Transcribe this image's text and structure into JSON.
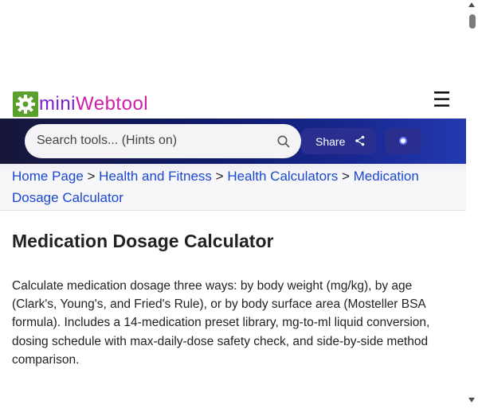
{
  "header": {
    "brand_prefix": "mini",
    "brand_suffix": "Webtool",
    "logo_color": "#5aa02c",
    "menu_icon": "hamburger-icon"
  },
  "search": {
    "placeholder": "Search tools... (Hints on)",
    "icon": "search-icon"
  },
  "actions": {
    "share_label": "Share",
    "share_icon": "share-icon",
    "theme_icon": "theme-toggle-icon"
  },
  "breadcrumb": {
    "items": [
      "Home Page",
      "Health and Fitness",
      "Health Calculators",
      "Medication Dosage Calculator"
    ],
    "separator": ">"
  },
  "main": {
    "title": "Medication Dosage Calculator",
    "description": "Calculate medication dosage three ways: by body weight (mg/kg), by age (Clark's, Young's, and Fried's Rule), or by body surface area (Mosteller BSA formula). Includes a 14-medication preset library, mg-to-ml liquid conversion, dosing schedule with max-daily-dose safety check, and side-by-side method comparison."
  },
  "colors": {
    "link": "#1a47d1",
    "band_start": "#17173a",
    "band_end": "#243ab0",
    "button": "#2a2f8f"
  }
}
